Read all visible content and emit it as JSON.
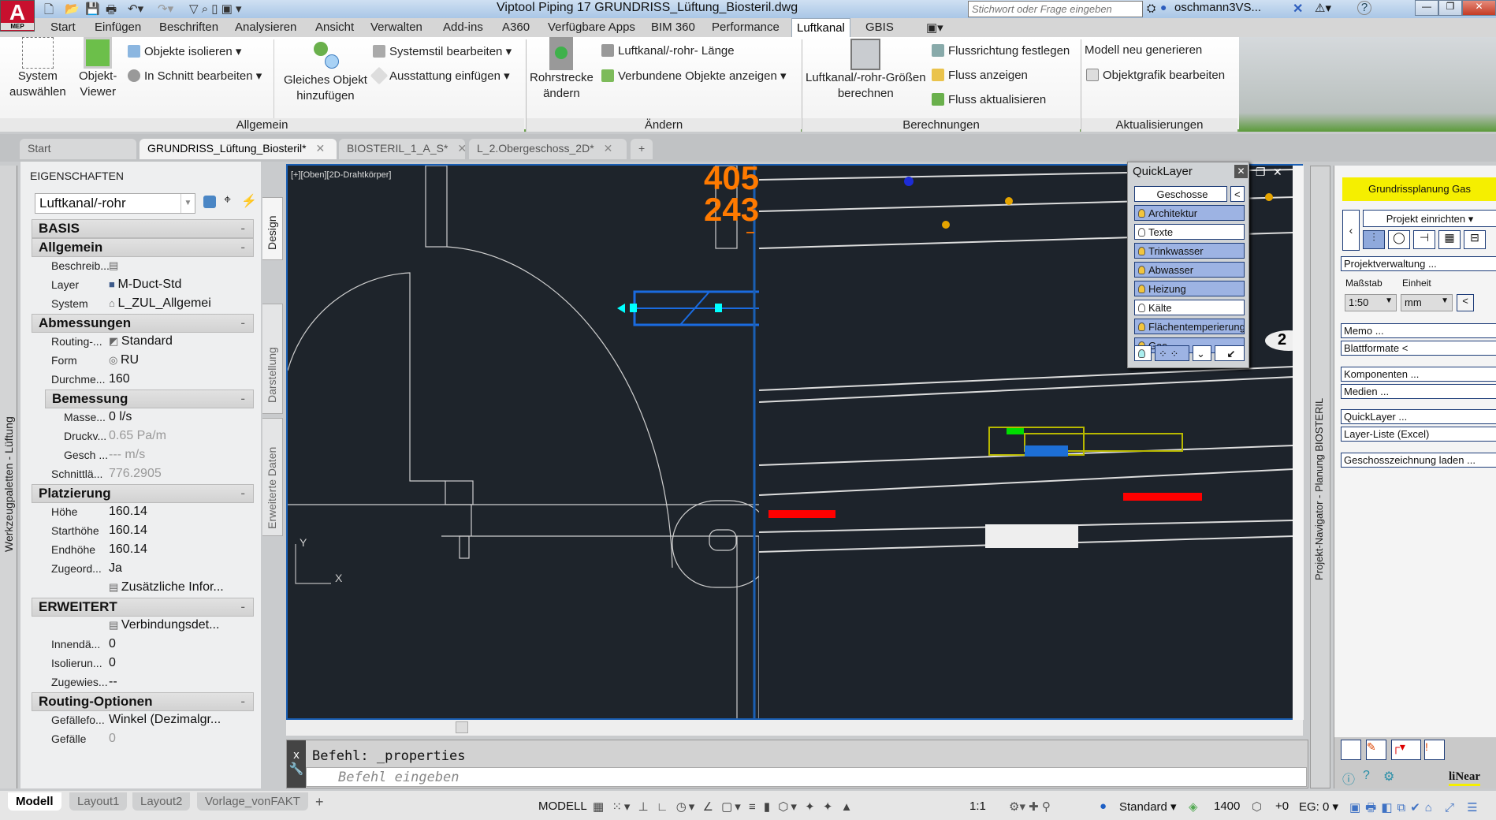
{
  "app": {
    "logo": "A",
    "logo_sub": "MEP",
    "title": "Viptool Piping 17   GRUNDRISS_Lüftung_Biosteril.dwg",
    "search_placeholder": "Stichwort oder Frage eingeben",
    "user": "oschmann3VS...",
    "help": "?"
  },
  "menu": {
    "tabs": [
      "Start",
      "Einfügen",
      "Beschriften",
      "Analysieren",
      "Ansicht",
      "Verwalten",
      "Add-ins",
      "A360",
      "Verfügbare Apps",
      "BIM 360",
      "Performance",
      "Luftkanal",
      "GBIS"
    ],
    "active": "Luftkanal"
  },
  "ribbon": {
    "allgemein": {
      "label": "Allgemein",
      "system": "System",
      "system2": "auswählen",
      "viewer": "Objekt-",
      "viewer2": "Viewer",
      "isolate": "Objekte isolieren",
      "section": "In Schnitt bearbeiten",
      "same": "Gleiches Objekt",
      "same2": "hinzufügen",
      "style": "Systemstil bearbeiten",
      "equip": "Ausstattung einfügen"
    },
    "aendern": {
      "label": "Ändern",
      "route": "Rohrstrecke",
      "route2": "ändern",
      "length": "Luftkanal/-rohr- Länge",
      "connected": "Verbundene Objekte anzeigen"
    },
    "berechnungen": {
      "label": "Berechnungen",
      "calc": "Luftkanal/-rohr-Größen",
      "calc2": "berechnen",
      "flowdir": "Flussrichtung festlegen",
      "flowshow": "Fluss anzeigen",
      "flowupd": "Fluss aktualisieren"
    },
    "aktualisierungen": {
      "label": "Aktualisierungen",
      "regen": "Modell neu generieren",
      "graphic": "Objektgrafik bearbeiten"
    }
  },
  "doc_tabs": [
    "Start",
    "GRUNDRISS_Lüftung_Biosteril*",
    "BIOSTERIL_1_A_S*",
    "L_2.Obergeschoss_2D*"
  ],
  "doc_tab_active": "GRUNDRISS_Lüftung_Biosteril*",
  "left_palette": "Werkzeugpaletten - Lüftung",
  "properties": {
    "title": "EIGENSCHAFTEN",
    "object": "Luftkanal/-rohr",
    "rows": [
      {
        "t": "h",
        "k": "BASIS"
      },
      {
        "t": "h",
        "k": "Allgemein"
      },
      {
        "k": "Beschreib...",
        "v": "",
        "icon": "table"
      },
      {
        "k": "Layer",
        "v": "M-Duct-Std",
        "icon": "square"
      },
      {
        "k": "System",
        "v": "L_ZUL_Allgemei",
        "icon": "system"
      },
      {
        "t": "h",
        "k": "Abmessungen"
      },
      {
        "k": "Routing-...",
        "v": "Standard",
        "icon": "routing"
      },
      {
        "k": "Form",
        "v": "RU",
        "icon": "round"
      },
      {
        "k": "Durchme...",
        "v": "160"
      },
      {
        "t": "hs",
        "k": "Bemessung"
      },
      {
        "t": "s",
        "k": "Masse...",
        "v": "0 l/s"
      },
      {
        "t": "s",
        "k": "Druckv...",
        "v": "0.65 Pa/m",
        "grey": true
      },
      {
        "t": "s",
        "k": "Gesch ...",
        "v": "--- m/s",
        "grey": true
      },
      {
        "k": "Schnittlä...",
        "v": "776.2905",
        "grey": true
      },
      {
        "t": "h",
        "k": "Platzierung"
      },
      {
        "k": "Höhe",
        "v": "160.14"
      },
      {
        "k": "Starthöhe",
        "v": "160.14"
      },
      {
        "k": "Endhöhe",
        "v": "160.14"
      },
      {
        "k": "Zugeord...",
        "v": "Ja"
      },
      {
        "k": "",
        "v": "Zusätzliche Infor...",
        "icon": "table"
      },
      {
        "t": "h",
        "k": "ERWEITERT"
      },
      {
        "k": "",
        "v": "Verbindungsdet...",
        "icon": "table"
      },
      {
        "k": "Innendä...",
        "v": "0"
      },
      {
        "k": "Isolierun...",
        "v": "0"
      },
      {
        "k": "Zugewies...",
        "v": "--"
      },
      {
        "t": "h",
        "k": "Routing-Optionen"
      },
      {
        "k": "Gefällefo...",
        "v": "Winkel  (Dezimalgr..."
      },
      {
        "k": "Gefälle",
        "v": "0",
        "grey": true
      }
    ],
    "side_tabs": [
      "Design",
      "Darstellung",
      "Erweiterte Daten"
    ]
  },
  "viewport": {
    "label": "[+][Oben][2D-Drahtkörper]",
    "dim1": "405",
    "dim2": "243",
    "ucs_x": "X",
    "ucs_y": "Y",
    "bubble": "2"
  },
  "command": {
    "history": "Befehl:  _properties",
    "placeholder": "Befehl eingeben"
  },
  "quicklayer": {
    "title": "QuickLayer",
    "floors": "Geschosse",
    "back": "<",
    "items": [
      {
        "label": "Architektur",
        "on": true
      },
      {
        "label": "Texte",
        "on": false
      },
      {
        "label": "Trinkwasser",
        "on": true
      },
      {
        "label": "Abwasser",
        "on": true
      },
      {
        "label": "Heizung",
        "on": true
      },
      {
        "label": "Kälte",
        "on": false
      },
      {
        "label": "Flächentemperierung",
        "on": true
      },
      {
        "label": "Gas",
        "on": true
      }
    ]
  },
  "navigator": {
    "title": "Projekt-Navigator - Planung BIOSTERIL",
    "header": "Grundrissplanung Gas",
    "header_color": "#f5ef00",
    "section": "Projekt einrichten",
    "project_mgmt": "Projektverwaltung ...",
    "scale_label": "Maßstab",
    "scale": "1:50",
    "unit_label": "Einheit",
    "unit": "mm",
    "back": "<",
    "buttons": [
      "Memo ...",
      "Blattformate <",
      "Komponenten ...",
      "Medien ...",
      "QuickLayer ...",
      "Layer-Liste (Excel)",
      "Geschosszeichnung laden ..."
    ],
    "brand": "liNear"
  },
  "layouts": {
    "tabs": [
      "Modell",
      "Layout1",
      "Layout2",
      "Vorlage_vonFAKT"
    ],
    "active": "Modell"
  },
  "status": {
    "space": "MODELL",
    "scale": "1:1",
    "style": "Standard",
    "value": "1400",
    "offset": "+0",
    "eg": "EG: 0"
  }
}
